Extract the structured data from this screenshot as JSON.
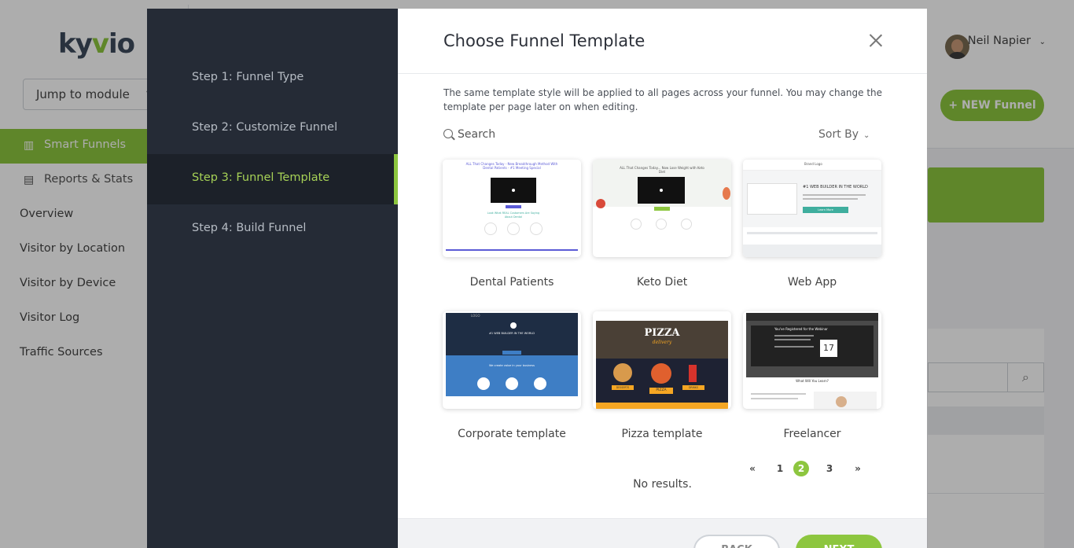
{
  "app": {
    "logo": "kyvio",
    "jump_module": "Jump to module",
    "nav": [
      {
        "label": "Smart Funnels",
        "active": true
      },
      {
        "label": "Reports & Stats",
        "active": false
      }
    ],
    "sub_nav": [
      "Overview",
      "Visitor by Location",
      "Visitor by Device",
      "Visitor Log",
      "Traffic Sources"
    ],
    "user_name": "Neil Napier",
    "new_funnel_label": "+ NEW Funnel"
  },
  "modal": {
    "steps": [
      {
        "label": "Step 1: Funnel Type",
        "active": false
      },
      {
        "label": "Step 2: Customize Funnel",
        "active": false
      },
      {
        "label": "Step 3: Funnel Template",
        "active": true
      },
      {
        "label": "Step 4: Build Funnel",
        "active": false
      }
    ],
    "title": "Choose Funnel Template",
    "description": "The same template style will be applied to all pages across your funnel. You may change the template per page later on when editing.",
    "search_label": "Search",
    "sort_label": "Sort By",
    "templates": [
      {
        "name": "Dental Patients",
        "thumb": {
          "headline": "ALL That Changes Today - New Breakthrough Method With Dental Patients - #1 Meeting Special",
          "subhead": "Look What REAL Customers Are Saying About Dental",
          "accent": "#5b5bd6"
        }
      },
      {
        "name": "Keto Diet",
        "thumb": {
          "headline": "ALL That Changes Today... Now Lose Weight with Keto Diet",
          "accent": "#8dc63f"
        }
      },
      {
        "name": "Web App",
        "thumb": {
          "brand": "Brand Logo",
          "headline": "#1 WEB BUILDER IN THE WORLD",
          "cta": "Learn More",
          "accent": "#3fae9e"
        }
      },
      {
        "name": "Corporate template",
        "thumb": {
          "logo": "LOGO",
          "headline": "#1 WEB BUILDER IN THE WORLD",
          "subhead": "We create value in your business",
          "accent": "#3e7ec5"
        }
      },
      {
        "name": "Pizza template",
        "thumb": {
          "title": "PIZZA",
          "subtitle": "delivery",
          "labels": [
            "DESSERTS",
            "PIZZA",
            "DRINKS"
          ],
          "accent": "#f5a623"
        }
      },
      {
        "name": "Freelancer",
        "thumb": {
          "headline": "You've Registered for the Webinar",
          "date": "17",
          "subhead": "What Will You Learn?",
          "accent": "#f5a623"
        }
      }
    ],
    "pagination": {
      "prev": "«",
      "pages": [
        "1",
        "2",
        "3"
      ],
      "current": "2",
      "next": "»"
    },
    "no_results": "No results.",
    "back_label": "BACK",
    "next_label": "NEXT"
  }
}
